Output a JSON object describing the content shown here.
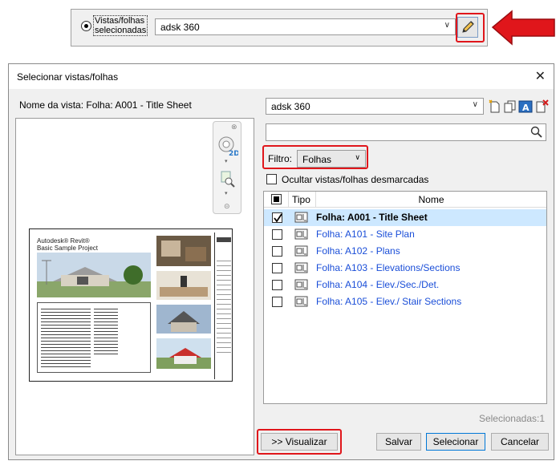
{
  "top_bar": {
    "radio_label": "Vistas/folhas selecionadas",
    "selected_value": "adsk 360",
    "edit_icon": "pencil-icon"
  },
  "callout_arrow": {
    "color": "#e0161b",
    "icon": "arrow-left-icon"
  },
  "dialog": {
    "title": "Selecionar vistas/folhas",
    "preview_label": "Nome da vista: Folha: A001 - Title Sheet",
    "project_combo_value": "adsk 360",
    "toolbar_icons": [
      "new-sheet-icon",
      "copy-icon",
      "rename-icon",
      "delete-icon"
    ],
    "search_placeholder": "",
    "filter": {
      "label": "Filtro:",
      "value": "Folhas"
    },
    "hide_unchecked_label": "Ocultar vistas/folhas desmarcadas",
    "columns": {
      "tipo": "Tipo",
      "nome": "Nome"
    },
    "rows": [
      {
        "name": "Folha: A001 - Title Sheet",
        "checked": true,
        "selected": true
      },
      {
        "name": "Folha: A101 - Site Plan",
        "checked": false,
        "selected": false
      },
      {
        "name": "Folha: A102 - Plans",
        "checked": false,
        "selected": false
      },
      {
        "name": "Folha: A103 - Elevations/Sections",
        "checked": false,
        "selected": false
      },
      {
        "name": "Folha: A104 - Elev./Sec./Det.",
        "checked": false,
        "selected": false
      },
      {
        "name": "Folha: A105 - Elev./ Stair Sections",
        "checked": false,
        "selected": false
      }
    ],
    "selected_count": "Selecionadas:1",
    "buttons": {
      "preview": ">> Visualizar",
      "save": "Salvar",
      "select": "Selecionar",
      "cancel": "Cancelar"
    },
    "sheet_preview": {
      "brand": "Autodesk® Revit®",
      "project": "Basic Sample Project"
    }
  },
  "colors": {
    "highlight": "#e0161b",
    "link": "#1a4ed8",
    "selection": "#cde8ff"
  }
}
